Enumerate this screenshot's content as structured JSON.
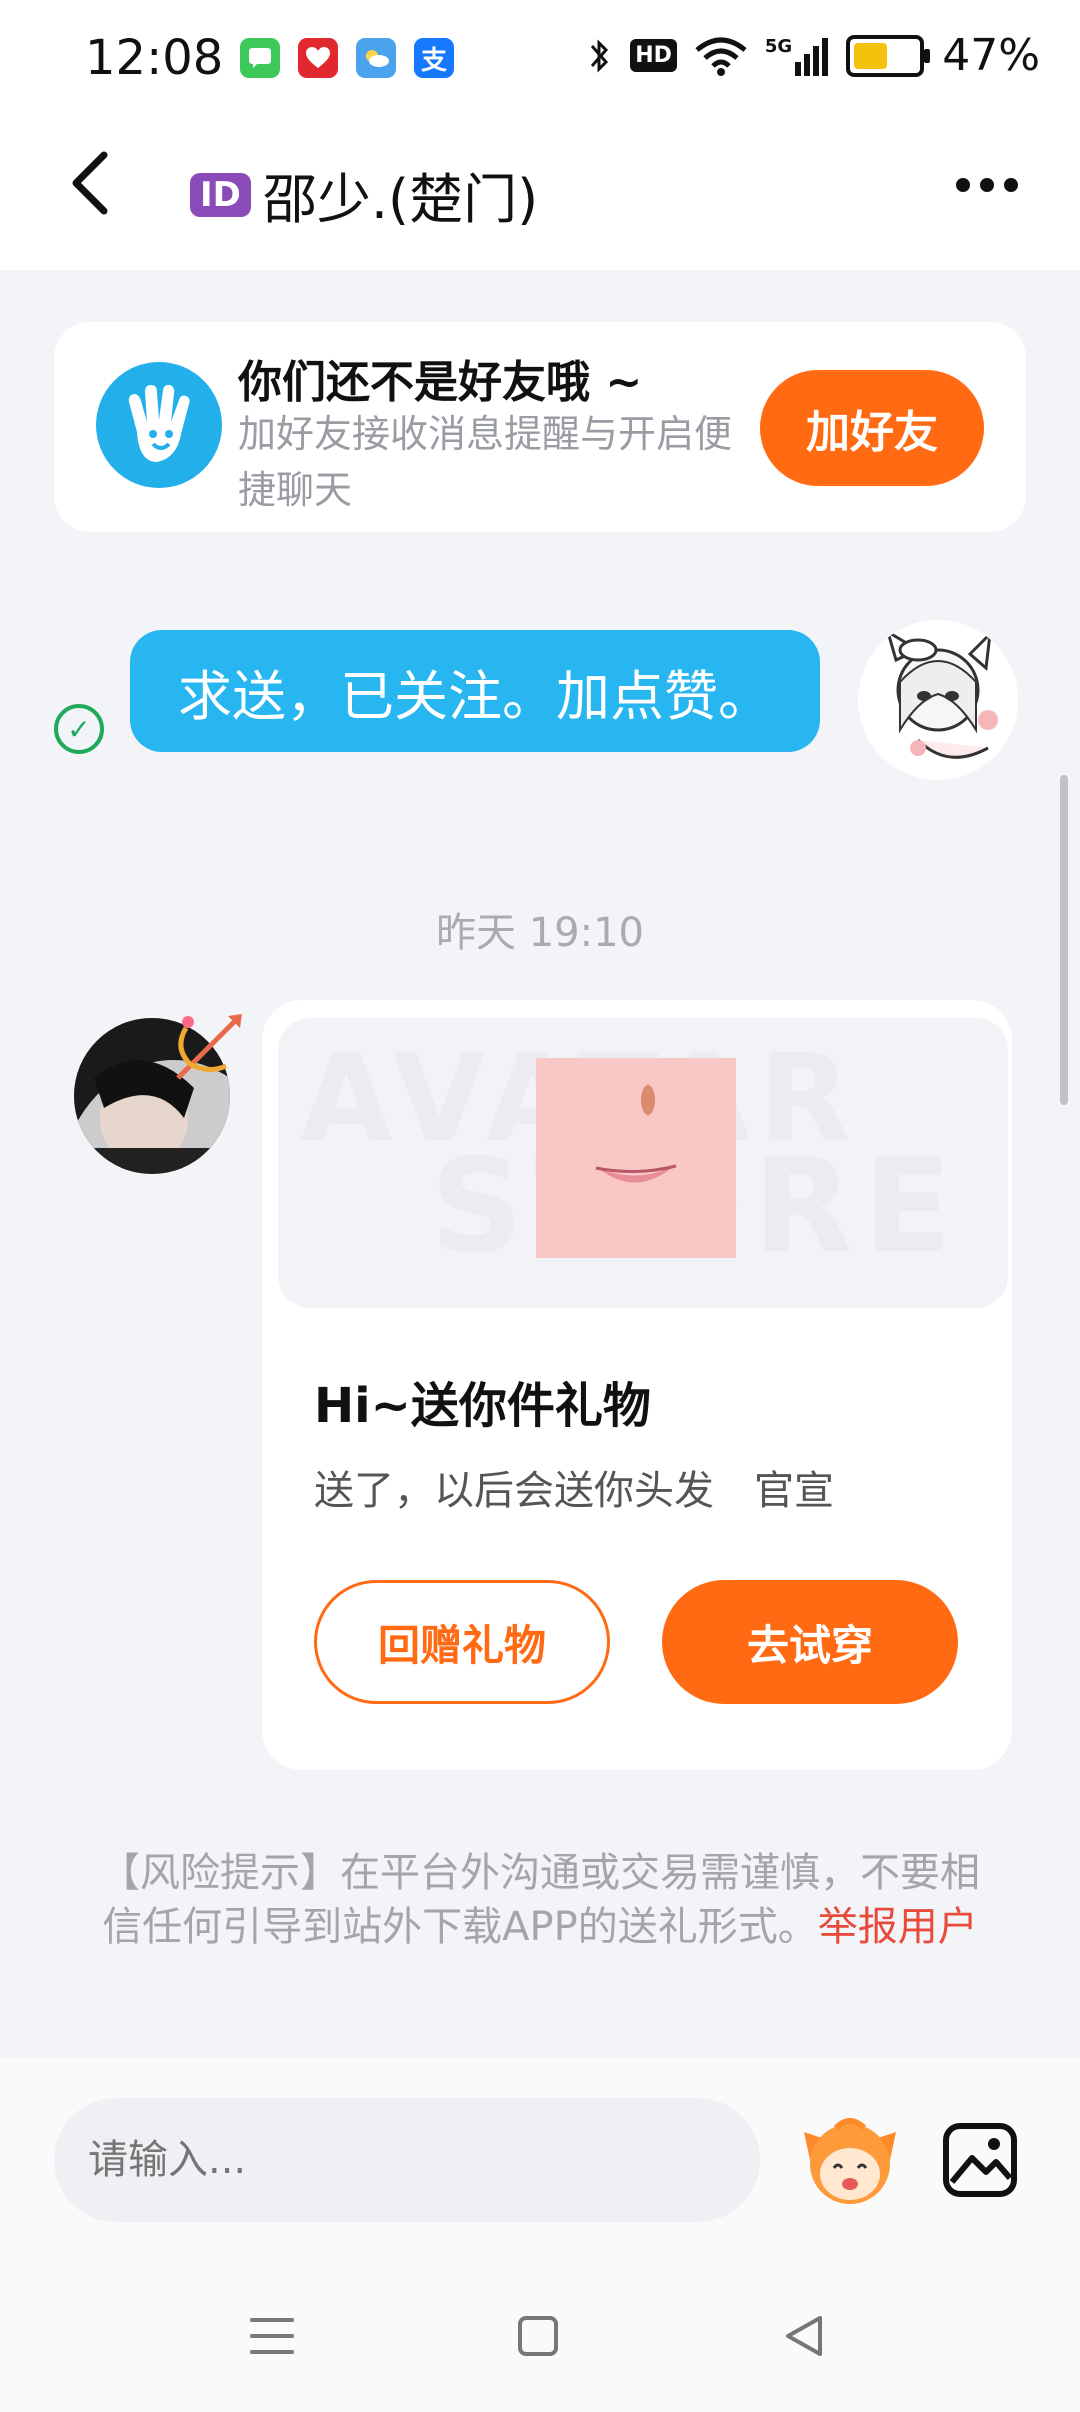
{
  "status_bar": {
    "time": "12:08",
    "network": "5G",
    "hd": "HD",
    "battery_percent": "47%",
    "battery_level": 0.47,
    "notification_icons": [
      "messages-icon",
      "gift-app-icon",
      "weather-icon",
      "alipay-icon"
    ],
    "alipay_glyph": "支"
  },
  "header": {
    "id_badge": "ID",
    "title": "邵少.(楚门)",
    "back_icon": "chevron-left-icon",
    "menu_icon": "more-dots-icon"
  },
  "friend_card": {
    "title": "你们还不是好友哦 ~",
    "subtitle": "加好友接收消息提醒与开启便捷聊天",
    "add_button": "加好友",
    "icon": "waving-hand-icon"
  },
  "outgoing_message": {
    "text": "求送，已关注。加点赞。",
    "status_icon": "read-check-icon"
  },
  "timestamp": "昨天 19:10",
  "gift_card": {
    "title": "Hi~送你件礼物",
    "description": "送了，以后会送你头发　官宣",
    "return_button": "回赠礼物",
    "try_button": "去试穿",
    "watermark_line1": "AVATAR",
    "watermark_line2": "STORE"
  },
  "risk_notice": {
    "text": "【风险提示】在平台外沟通或交易需谨慎，不要相信任何引导到站外下载APP的送礼形式。",
    "link": "举报用户"
  },
  "input": {
    "placeholder": "请输入..."
  },
  "colors": {
    "accent": "#ff6a13",
    "bubble": "#28b6f0",
    "report": "#e84b3c"
  }
}
